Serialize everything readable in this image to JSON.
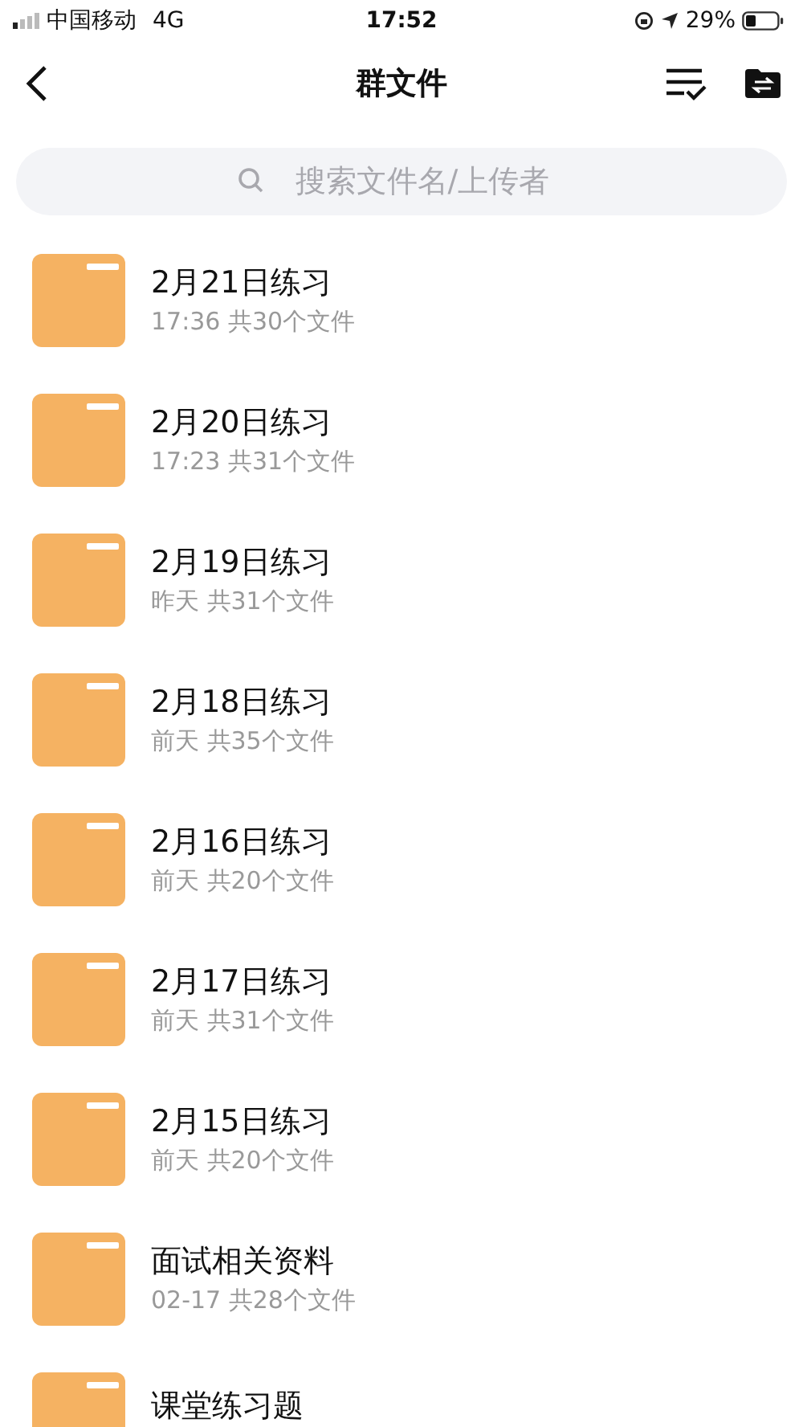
{
  "status_bar": {
    "carrier": "中国移动",
    "network": "4G",
    "time": "17:52",
    "battery": "29%"
  },
  "nav": {
    "title": "群文件"
  },
  "search": {
    "placeholder": "搜索文件名/上传者"
  },
  "folders": [
    {
      "name": "2月21日练习",
      "meta": "17:36 共30个文件"
    },
    {
      "name": "2月20日练习",
      "meta": "17:23 共31个文件"
    },
    {
      "name": "2月19日练习",
      "meta": "昨天 共31个文件"
    },
    {
      "name": "2月18日练习",
      "meta": "前天 共35个文件"
    },
    {
      "name": "2月16日练习",
      "meta": "前天 共20个文件"
    },
    {
      "name": "2月17日练习",
      "meta": "前天 共31个文件"
    },
    {
      "name": "2月15日练习",
      "meta": "前天 共20个文件"
    },
    {
      "name": "面试相关资料",
      "meta": "02-17 共28个文件"
    },
    {
      "name": "课堂练习题"
    }
  ]
}
